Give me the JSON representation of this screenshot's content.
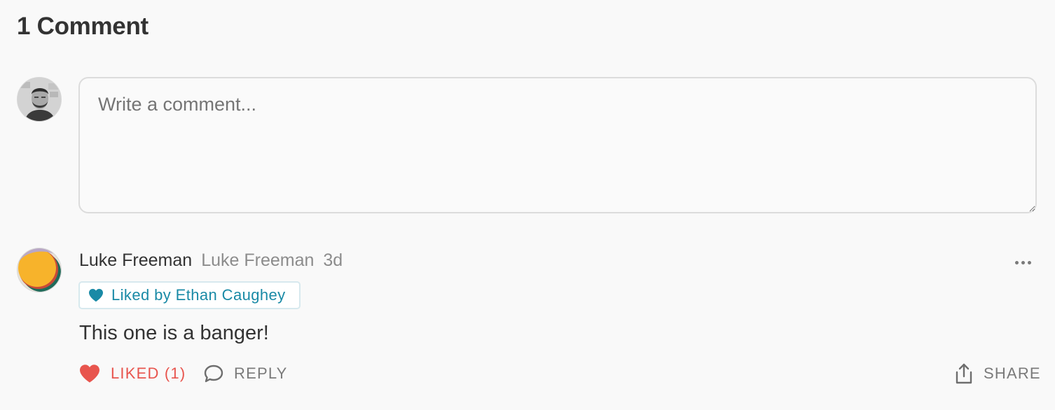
{
  "section": {
    "title": "1 Comment"
  },
  "composer": {
    "placeholder": "Write a comment..."
  },
  "comment": {
    "author": "Luke Freeman",
    "handle": "Luke Freeman",
    "time": "3d",
    "liked_by": "Liked by Ethan Caughey",
    "body": "This one is a banger!",
    "actions": {
      "like_label": "LIKED (1)",
      "reply_label": "REPLY",
      "share_label": "SHARE"
    }
  },
  "icons": {
    "more": "more-options-icon",
    "badge_heart": "heart-icon",
    "like": "heart-filled-icon",
    "reply": "speech-bubble-icon",
    "share": "share-upload-icon"
  },
  "colors": {
    "accent_like": "#e8554e",
    "badge_text": "#1a8aa6",
    "muted": "#8c8c8c"
  }
}
